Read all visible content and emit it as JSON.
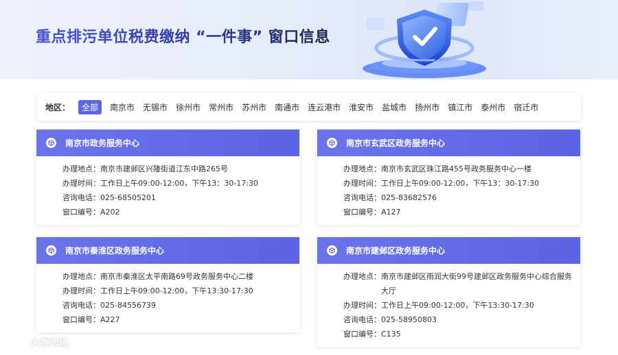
{
  "banner": {
    "title": "重点排污单位税费缴纳 “一件事” 窗口信息"
  },
  "filter": {
    "label": "地区：",
    "regions": [
      "全部",
      "南京市",
      "无锡市",
      "徐州市",
      "常州市",
      "苏州市",
      "南通市",
      "连云港市",
      "淮安市",
      "盐城市",
      "扬州市",
      "镇江市",
      "泰州市",
      "宿迁市"
    ],
    "active_index": 0
  },
  "field_labels": {
    "address": "办理地点：",
    "hours": "办理时间：",
    "phone": "咨询电话：",
    "window": "窗口编号："
  },
  "centers": [
    {
      "name": "南京市政务服务中心",
      "address": "南京市建邺区兴隆街道江东中路265号",
      "hours": "工作日上午09:00-12:00，下午13：30-17:30",
      "phone": "025-68505201",
      "window": "A202"
    },
    {
      "name": "南京市玄武区政务服务中心",
      "address": "南京市玄武区珠江路455号政务服务中心一楼",
      "hours": "工作日上午09:00-12:00，下午13：30-17:30",
      "phone": "025-83682576",
      "window": "A127"
    },
    {
      "name": "南京市秦淮区政务服务中心",
      "address": "南京市秦淮区太平南路69号政务服务中心二楼",
      "hours": "工作日上午09:00-12:00，下午13:30-17:30",
      "phone": "025-84556739",
      "window": "A227"
    },
    {
      "name": "南京市建邺区政务服务中心",
      "address": "南京市建邺区雨润大街99号建邺区政务服务中心综合服务大厅",
      "hours": "工作日上午09:00-12:00，下午13:30-17:30",
      "phone": "025-58950803",
      "window": "C135"
    }
  ],
  "watermark": "大数跨境",
  "colors": {
    "accent": "#5b66e6",
    "title_start": "#4a4fd8",
    "title_end": "#1c2150"
  },
  "icons": {
    "card": "cube-icon",
    "hero": "shield-illustration",
    "watermark": "brand-logo-icon"
  }
}
